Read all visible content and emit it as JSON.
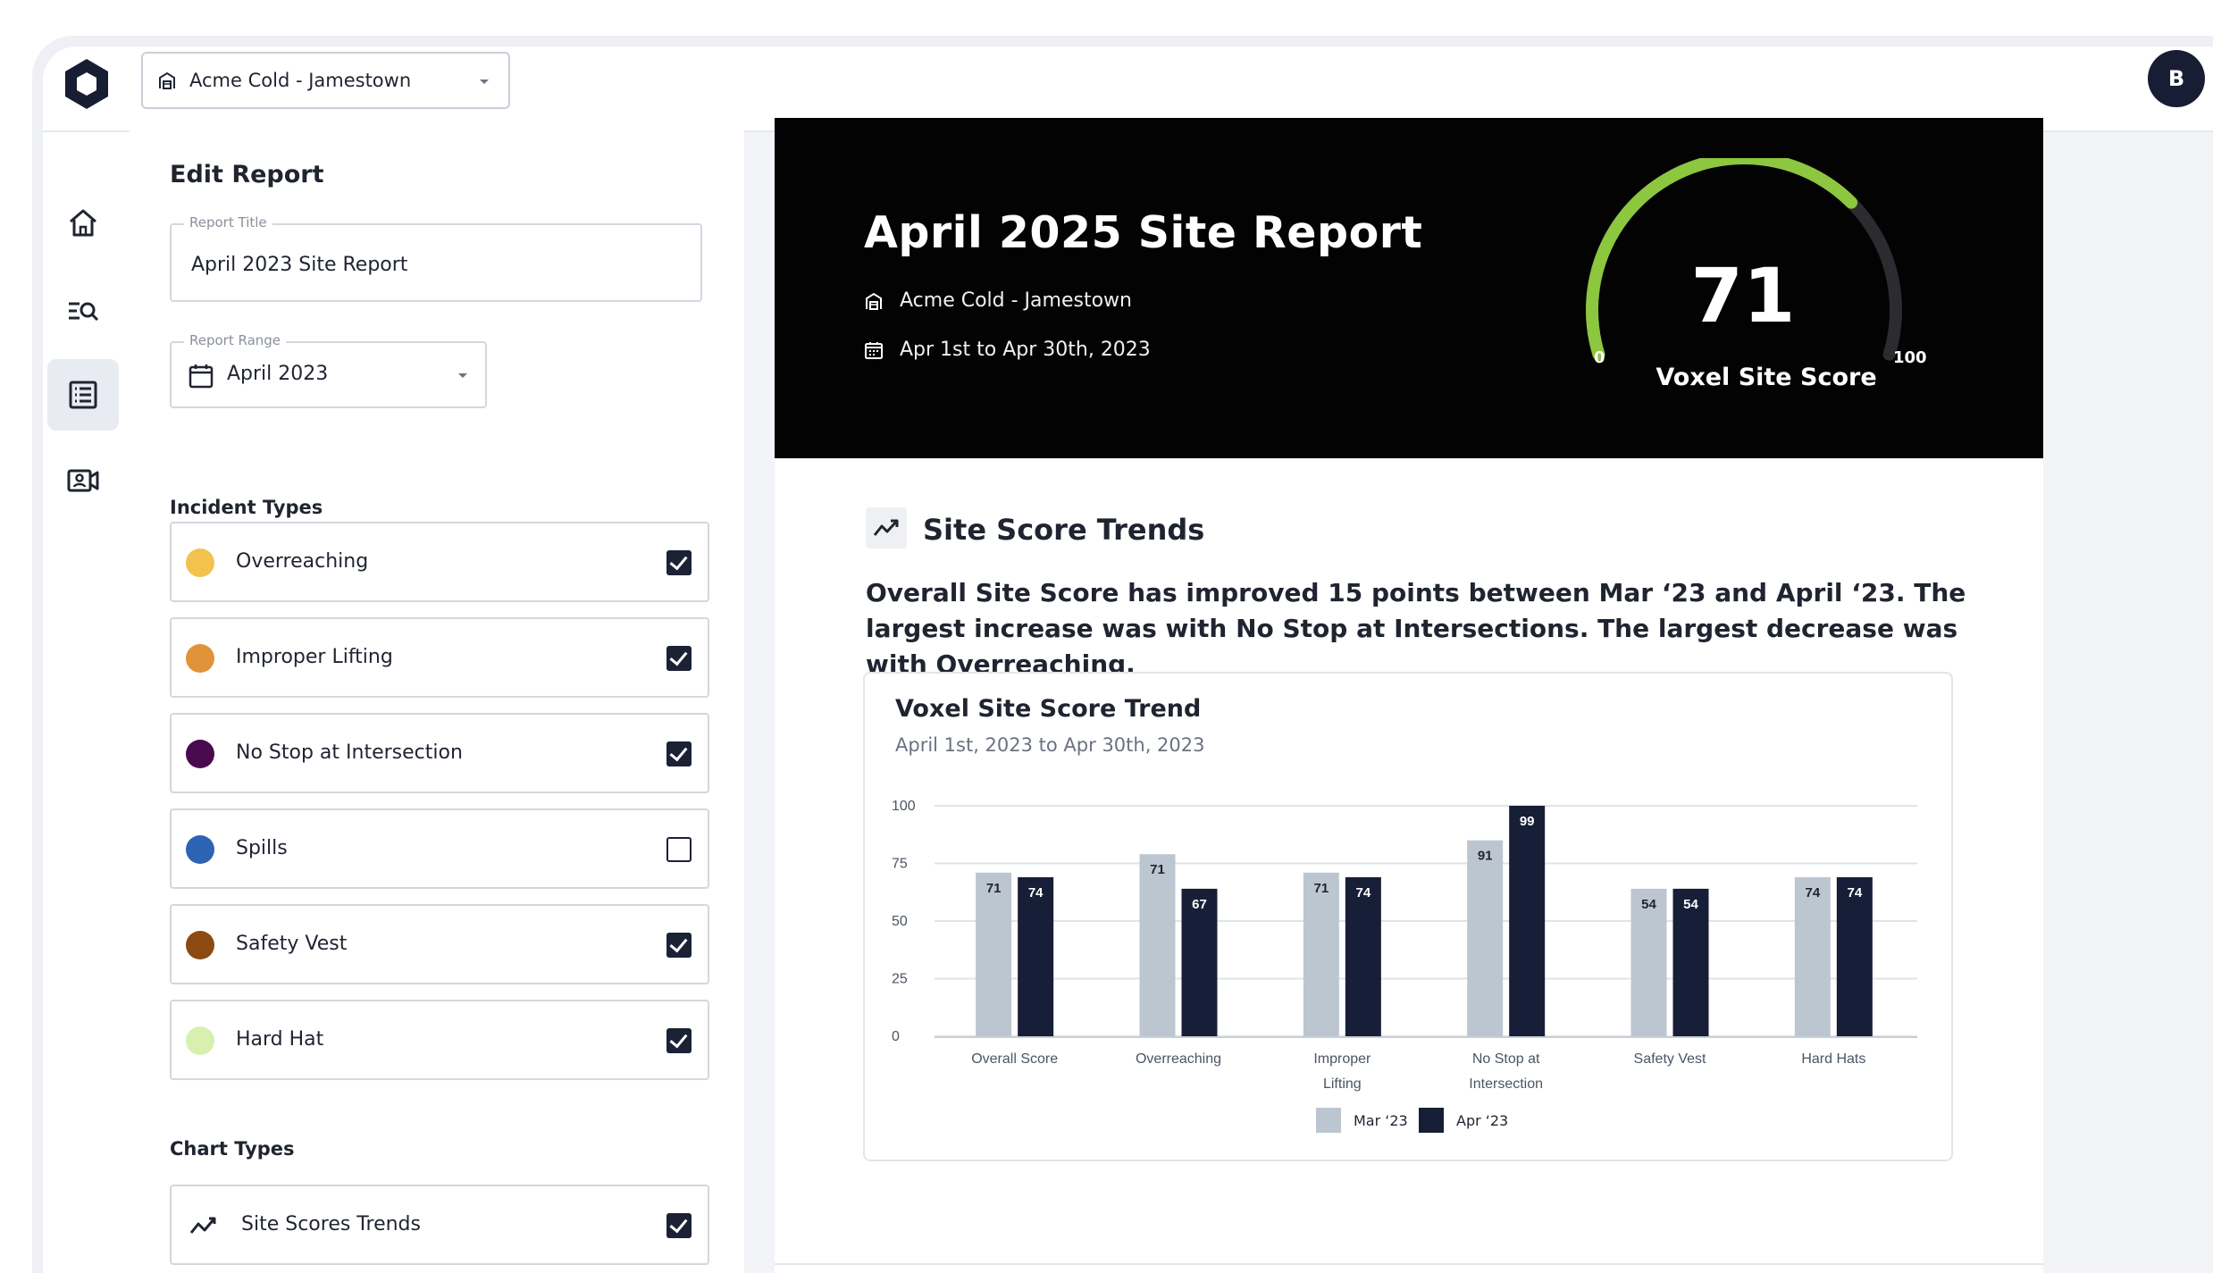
{
  "header": {
    "site_name": "Acme Cold - Jamestown",
    "avatar_initial": "B"
  },
  "sidebar": {
    "items": [
      {
        "icon": "home-icon",
        "active": false
      },
      {
        "icon": "search-list-icon",
        "active": false
      },
      {
        "icon": "report-list-icon",
        "active": true
      },
      {
        "icon": "video-camera-icon",
        "active": false
      }
    ]
  },
  "edit_report": {
    "title": "Edit Report",
    "report_title_label": "Report Title",
    "report_title_value": "April 2023 Site Report",
    "report_range_label": "Report Range",
    "report_range_value": "April 2023",
    "incident_types_label": "Incident Types",
    "incident_types": [
      {
        "label": "Overreaching",
        "color": "#F2C14E",
        "checked": true
      },
      {
        "label": "Improper Lifting",
        "color": "#E09338",
        "checked": true
      },
      {
        "label": "No Stop at Intersection",
        "color": "#4A0A4E",
        "checked": true
      },
      {
        "label": "Spills",
        "color": "#2D63B3",
        "checked": false
      },
      {
        "label": "Safety Vest",
        "color": "#8A4A12",
        "checked": true
      },
      {
        "label": "Hard Hat",
        "color": "#D7F0B0",
        "checked": true
      }
    ],
    "chart_types_label": "Chart Types",
    "chart_types": [
      {
        "label": "Site Scores Trends",
        "icon": "trend-icon",
        "checked": true
      }
    ]
  },
  "report": {
    "title": "April 2025 Site Report",
    "site": "Acme Cold - Jamestown",
    "date_range": "Apr 1st to Apr 30th, 2023",
    "score": "71",
    "score_value": 71,
    "score_min": "0",
    "score_max": "100",
    "score_label": "Voxel Site Score",
    "gauge_color": "#8DC63F",
    "gauge_track_color": "#2b2b30"
  },
  "trends": {
    "title": "Site Score Trends",
    "summary": "Overall Site Score has improved 15 points between Mar ‘23 and April ‘23. The largest increase was with No Stop at Intersections. The largest decrease was with Overreaching."
  },
  "chart_card": {
    "title": "Voxel Site Score Trend",
    "subtitle": "April 1st, 2023 to Apr 30th, 2023"
  },
  "chart_data": {
    "type": "bar",
    "title": "Voxel Site Score Trend",
    "subtitle": "April 1st, 2023 to Apr 30th, 2023",
    "categories": [
      [
        "Overall Score"
      ],
      [
        "Overreaching"
      ],
      [
        "Improper",
        "Lifting"
      ],
      [
        "No Stop at",
        "Intersection"
      ],
      [
        "Safety Vest"
      ],
      [
        "Hard Hats"
      ]
    ],
    "series": [
      {
        "name": "Mar ‘23",
        "color": "#BCC6D0",
        "values": [
          71,
          71,
          71,
          91,
          54,
          74
        ],
        "display": [
          71,
          79,
          71,
          85,
          64,
          69
        ]
      },
      {
        "name": "Apr ‘23",
        "color": "#171E37",
        "values": [
          74,
          67,
          74,
          99,
          54,
          74
        ],
        "display": [
          69,
          64,
          69,
          100,
          64,
          69
        ]
      }
    ],
    "y_ticks": [
      0,
      25,
      50,
      75,
      100
    ],
    "ylim": [
      0,
      100
    ],
    "grid": true,
    "legend": "bottom-center"
  }
}
